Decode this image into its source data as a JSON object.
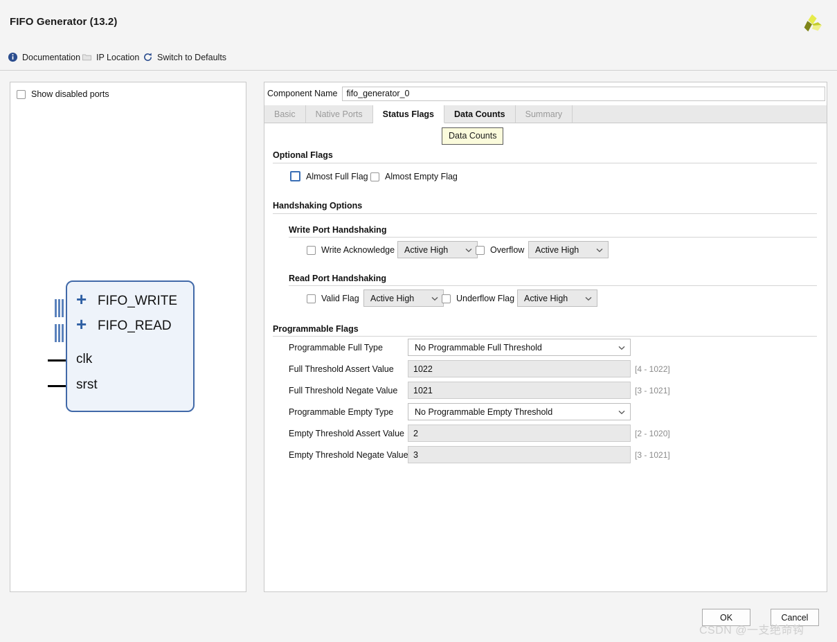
{
  "window": {
    "title": "FIFO Generator (13.2)",
    "logo_icon": "xilinx-pinwheel-logo"
  },
  "toolbar": {
    "items": [
      {
        "label": "Documentation",
        "icon": "info-icon",
        "enabled": true
      },
      {
        "label": "IP Location",
        "icon": "folder-icon",
        "enabled": false
      },
      {
        "label": "Switch to Defaults",
        "icon": "refresh-icon",
        "enabled": true
      }
    ]
  },
  "left_panel": {
    "show_disabled_ports": {
      "label": "Show disabled ports",
      "checked": false
    },
    "symbol": {
      "ports": [
        {
          "name": "FIFO_WRITE",
          "type": "bus",
          "expander": "+"
        },
        {
          "name": "FIFO_READ",
          "type": "bus",
          "expander": "+"
        },
        {
          "name": "clk",
          "type": "wire"
        },
        {
          "name": "srst",
          "type": "wire"
        }
      ]
    }
  },
  "right_panel": {
    "component_name": {
      "label": "Component Name",
      "value": "fifo_generator_0"
    },
    "tabs": [
      {
        "label": "Basic",
        "state": "disabled"
      },
      {
        "label": "Native Ports",
        "state": "disabled"
      },
      {
        "label": "Status Flags",
        "state": "active"
      },
      {
        "label": "Data Counts",
        "state": "hovered"
      },
      {
        "label": "Summary",
        "state": "disabled"
      }
    ],
    "tooltip": {
      "text": "Data Counts"
    },
    "optional_flags": {
      "title": "Optional Flags",
      "checkboxes": [
        {
          "label": "Almost Full Flag",
          "checked": false,
          "focused": true
        },
        {
          "label": "Almost Empty Flag",
          "checked": false,
          "focused": false
        }
      ]
    },
    "handshaking": {
      "title": "Handshaking Options",
      "write_port": {
        "title": "Write Port Handshaking",
        "controls": [
          {
            "label": "Write Acknowledge",
            "checked": false,
            "select_value": "Active High"
          },
          {
            "label": "Overflow",
            "checked": false,
            "select_value": "Active High"
          }
        ]
      },
      "read_port": {
        "title": "Read Port Handshaking",
        "controls": [
          {
            "label": "Valid Flag",
            "checked": false,
            "select_value": "Active High"
          },
          {
            "label": "Underflow Flag",
            "checked": false,
            "select_value": "Active High"
          }
        ]
      }
    },
    "programmable_flags": {
      "title": "Programmable Flags",
      "rows": [
        {
          "label": "Programmable Full Type",
          "kind": "select",
          "value": "No Programmable Full Threshold",
          "range": ""
        },
        {
          "label": "Full Threshold Assert Value",
          "kind": "text",
          "value": "1022",
          "range": "[4 - 1022]"
        },
        {
          "label": "Full Threshold Negate Value",
          "kind": "text",
          "value": "1021",
          "range": "[3 - 1021]"
        },
        {
          "label": "Programmable Empty Type",
          "kind": "select",
          "value": "No Programmable Empty Threshold",
          "range": ""
        },
        {
          "label": "Empty Threshold Assert Value",
          "kind": "text",
          "value": "2",
          "range": "[2 - 1020]"
        },
        {
          "label": "Empty Threshold Negate Value",
          "kind": "text",
          "value": "3",
          "range": "[3 - 1021]"
        }
      ]
    }
  },
  "footer": {
    "ok_label": "OK",
    "cancel_label": "Cancel"
  },
  "watermark": {
    "text": "CSDN @一支绝命钩"
  },
  "colors": {
    "accent_blue": "#3a6fb5",
    "symbol_fill": "#eef3fa",
    "symbol_border": "#4169a8",
    "tooltip_bg": "#fbfbdc",
    "panel_bg": "#f4f4f4",
    "logo_green": "#c8d22a"
  }
}
